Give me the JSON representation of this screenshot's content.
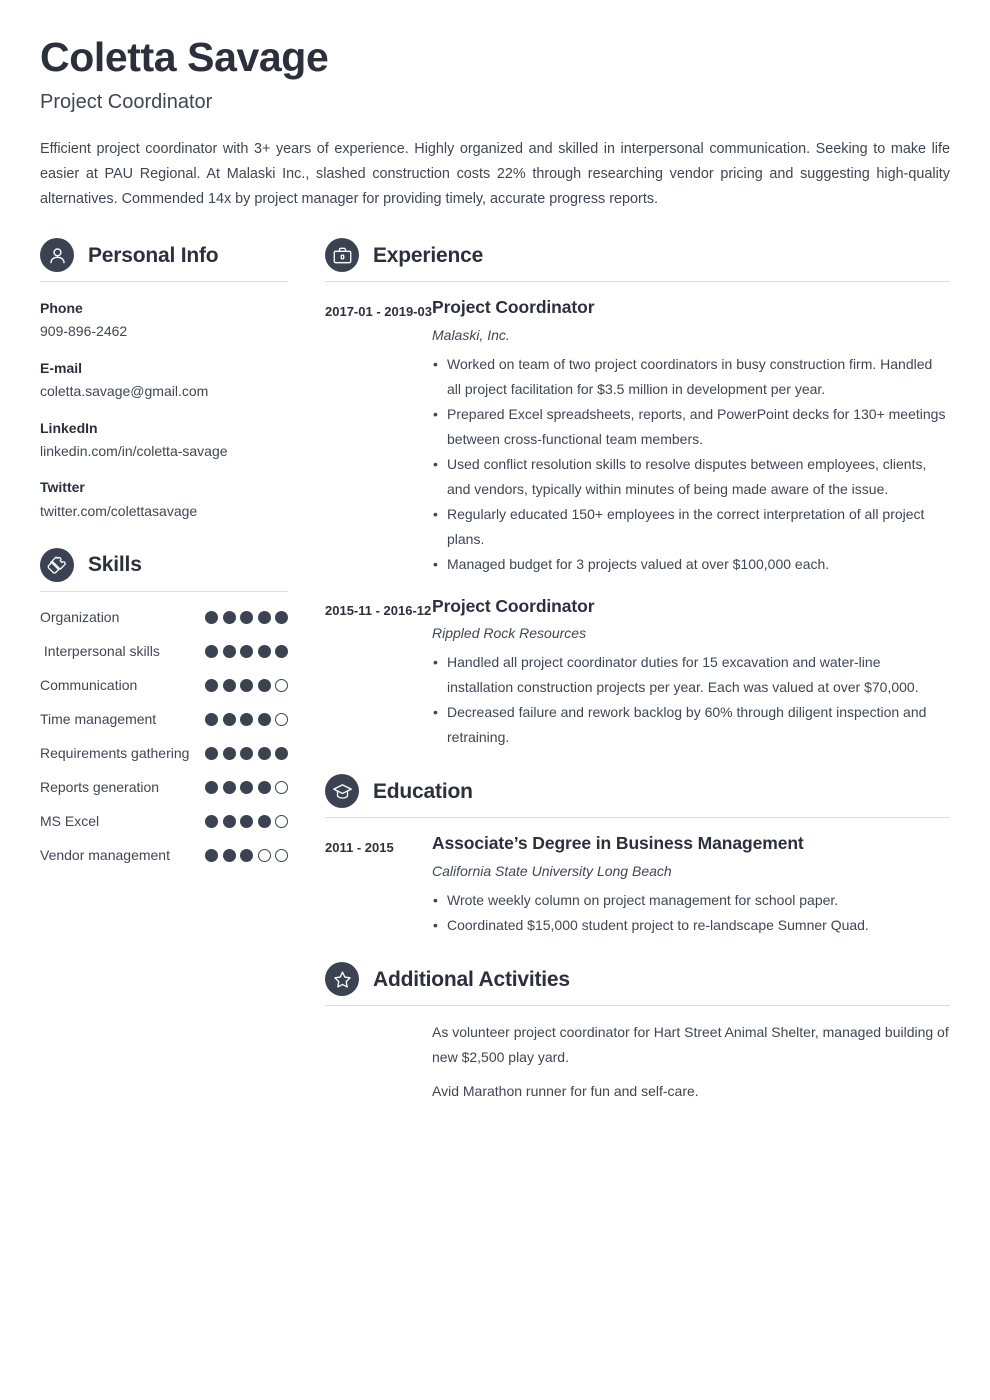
{
  "theme": {
    "accent": "#3b4252",
    "heading_color": "#2b303c",
    "text_color": "#3f4654",
    "rule_color": "#dcdee3",
    "page_background": "#ffffff"
  },
  "header": {
    "name": "Coletta Savage",
    "job_title": "Project Coordinator",
    "summary": "Efficient project coordinator with 3+ years of experience. Highly organized and skilled in interpersonal communication. Seeking to make life easier at PAU Regional. At Malaski Inc., slashed construction costs 22% through researching vendor pricing and suggesting high-quality alternatives. Commended 14x by project manager for providing timely, accurate progress reports."
  },
  "personal_info": {
    "title": "Personal Info",
    "icon": "person-icon",
    "items": [
      {
        "label": "Phone",
        "value": "909-896-2462"
      },
      {
        "label": "E-mail",
        "value": "coletta.savage@gmail.com"
      },
      {
        "label": "LinkedIn",
        "value": "linkedin.com/in/coletta-savage"
      },
      {
        "label": "Twitter",
        "value": "twitter.com/colettasavage"
      }
    ]
  },
  "skills": {
    "title": "Skills",
    "icon": "puzzle-piece-icon",
    "max_rating": 5,
    "items": [
      {
        "name": "Organization",
        "rating": 5
      },
      {
        "name": " Interpersonal skills",
        "rating": 5
      },
      {
        "name": "Communication",
        "rating": 4
      },
      {
        "name": "Time management",
        "rating": 4
      },
      {
        "name": "Requirements gathering",
        "rating": 5
      },
      {
        "name": "Reports generation",
        "rating": 4
      },
      {
        "name": "MS Excel",
        "rating": 4
      },
      {
        "name": "Vendor management",
        "rating": 3
      }
    ]
  },
  "experience": {
    "title": "Experience",
    "icon": "briefcase-icon",
    "entries": [
      {
        "date": "2017-01 - 2019-03",
        "title": "Project Coordinator",
        "organization": "Malaski, Inc.",
        "bullets": [
          "Worked on team of two project coordinators in busy construction firm. Handled all project facilitation for $3.5 million in development per year.",
          "Prepared Excel spreadsheets, reports, and PowerPoint decks for 130+ meetings between cross-functional team members.",
          "Used conflict resolution skills to resolve disputes between employees, clients, and vendors, typically within minutes of being made aware of the issue.",
          "Regularly educated 150+ employees in the correct interpretation of all project plans.",
          "Managed budget for 3 projects valued at over $100,000 each."
        ]
      },
      {
        "date": "2015-11 - 2016-12",
        "title": "Project Coordinator",
        "organization": "Rippled Rock Resources",
        "bullets": [
          "Handled all project coordinator duties for 15 excavation and water-line installation construction projects per year. Each was valued at over $70,000.",
          "Decreased failure and rework backlog by 60% through diligent inspection and retraining."
        ]
      }
    ]
  },
  "education": {
    "title": "Education",
    "icon": "graduation-cap-icon",
    "entries": [
      {
        "date": "2011 - 2015",
        "title": "Associate’s Degree in Business Management",
        "organization": "California State University Long Beach",
        "bullets": [
          "Wrote weekly column on project management for school paper.",
          "Coordinated $15,000 student project to re-landscape Sumner Quad."
        ]
      }
    ]
  },
  "additional_activities": {
    "title": "Additional Activities",
    "icon": "star-icon",
    "paragraphs": [
      "As volunteer project coordinator for Hart Street Animal Shelter, managed building of new $2,500 play yard.",
      "Avid Marathon runner for fun and self-care."
    ]
  }
}
